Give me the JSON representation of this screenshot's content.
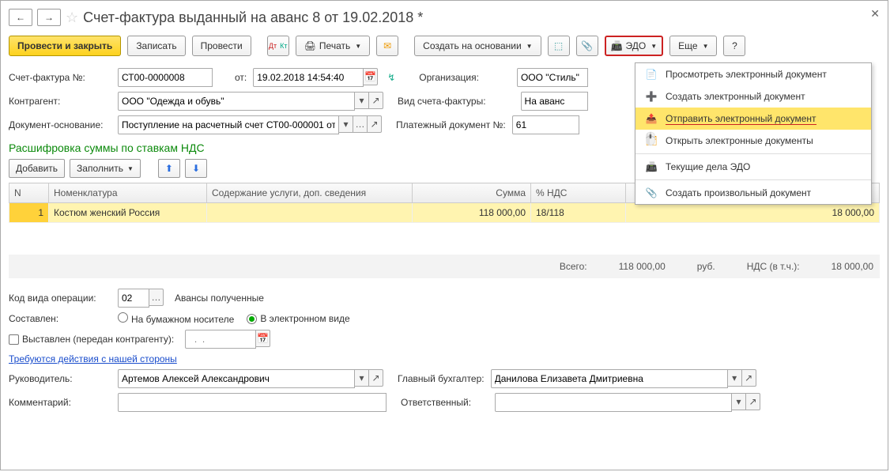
{
  "title": "Счет-фактура выданный на аванс 8 от 19.02.2018 *",
  "toolbar": {
    "post_close": "Провести и закрыть",
    "write": "Записать",
    "post": "Провести",
    "print": "Печать",
    "create_on_basis": "Создать на основании",
    "edo": "ЭДО",
    "more": "Еще",
    "help": "?"
  },
  "fields": {
    "invoice_no_lbl": "Счет-фактура №:",
    "invoice_no": "СТ00-0000008",
    "from_lbl": "от:",
    "date": "19.02.2018 14:54:40",
    "org_lbl": "Организация:",
    "org": "ООО \"Стиль\"",
    "counterparty_lbl": "Контрагент:",
    "counterparty": "ООО \"Одежда и обувь\"",
    "invoice_type_lbl": "Вид счета-фактуры:",
    "invoice_type": "На аванс",
    "basis_lbl": "Документ-основание:",
    "basis": "Поступление на расчетный счет СТ00-000001 от",
    "paydoc_lbl": "Платежный документ №:",
    "paydoc": "61"
  },
  "section_hdr": "Расшифровка суммы по ставкам НДС",
  "table_toolbar": {
    "add": "Добавить",
    "fill": "Заполнить"
  },
  "table": {
    "cols": {
      "n": "N",
      "nomenclature": "Номенклатура",
      "descr": "Содержание услуги, доп. сведения",
      "sum": "Сумма",
      "vat": "% НДС",
      "vat_sum": ""
    },
    "rows": [
      {
        "n": "1",
        "nomenclature": "Костюм женский Россия",
        "descr": "",
        "sum": "118 000,00",
        "vat": "18/118",
        "vat_sum": "18 000,00"
      }
    ],
    "totals": {
      "all_lbl": "Всего:",
      "all": "118 000,00",
      "cur": "руб.",
      "vat_lbl": "НДС (в т.ч.):",
      "vat": "18 000,00"
    }
  },
  "op_code_lbl": "Код вида операции:",
  "op_code": "02",
  "op_code_desc": "Авансы полученные",
  "composed_lbl": "Составлен:",
  "composed_paper": "На бумажном носителе",
  "composed_electronic": "В электронном виде",
  "issued_lbl": "Выставлен (передан контрагенту):",
  "action_link": "Требуются действия с нашей стороны",
  "manager_lbl": "Руководитель:",
  "manager": "Артемов Алексей Александрович",
  "accountant_lbl": "Главный бухгалтер:",
  "accountant": "Данилова Елизавета Дмитриевна",
  "comment_lbl": "Комментарий:",
  "responsible_lbl": "Ответственный:",
  "dropdown": {
    "view": "Просмотреть электронный документ",
    "create": "Создать электронный документ",
    "send": "Отправить электронный документ",
    "open": "Открыть электронные документы",
    "current": "Текущие дела ЭДО",
    "custom": "Создать произвольный документ"
  }
}
